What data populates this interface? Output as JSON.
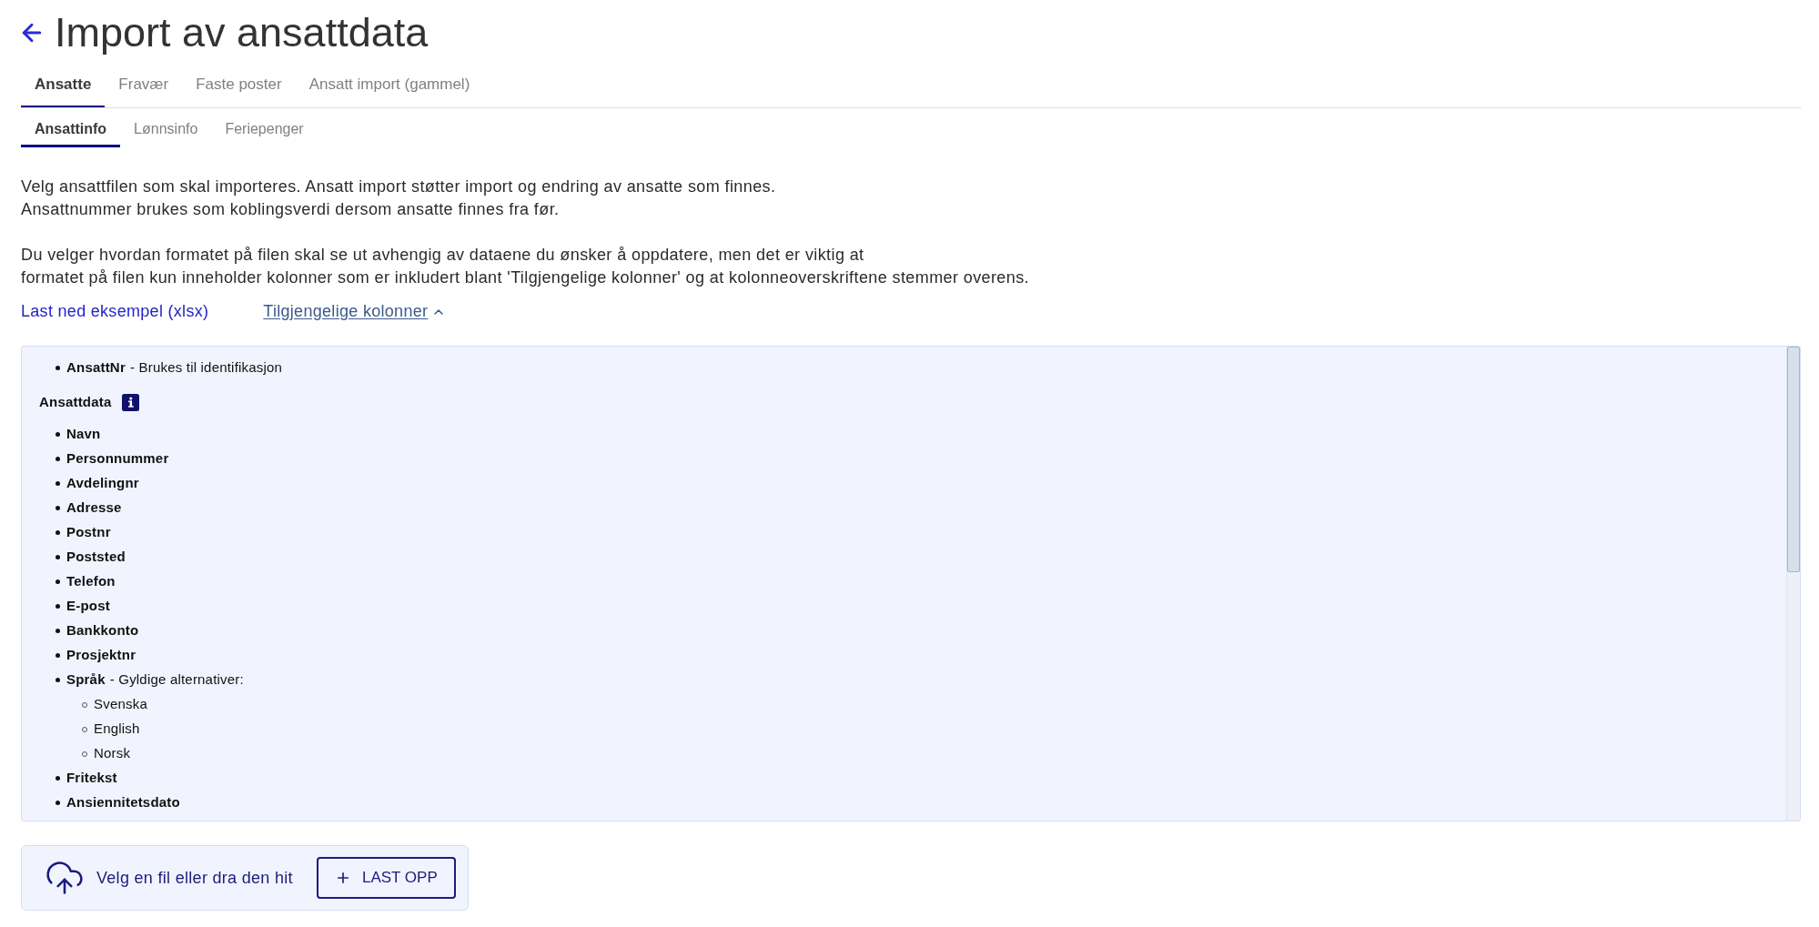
{
  "header": {
    "title": "Import av ansattdata"
  },
  "tabs": [
    {
      "label": "Ansatte",
      "selected": true
    },
    {
      "label": "Fravær",
      "selected": false
    },
    {
      "label": "Faste poster",
      "selected": false
    },
    {
      "label": "Ansatt import (gammel)",
      "selected": false
    }
  ],
  "subtabs": [
    {
      "label": "Ansattinfo",
      "selected": true
    },
    {
      "label": "Lønnsinfo",
      "selected": false
    },
    {
      "label": "Feriepenger",
      "selected": false
    }
  ],
  "description": [
    {
      "lines": [
        "Velg ansattfilen som skal importeres. Ansatt import støtter import og endring av ansatte som finnes.",
        "Ansattnummer brukes som koblingsverdi dersom ansatte finnes fra før."
      ]
    },
    {
      "lines": [
        "Du velger hvordan formatet på filen skal se ut avhengig av dataene du ønsker å oppdatere, men det er viktig at",
        "formatet på filen kun inneholder kolonner som er inkludert blant 'Tilgjengelige kolonner' og at kolonneoverskriftene stemmer overens."
      ]
    }
  ],
  "links": {
    "download": "Last ned eksempel (xlsx)",
    "columns_toggle": {
      "label": "Tilgjengelige kolonner",
      "expanded": true
    }
  },
  "columns_panel": {
    "key_columns": [
      {
        "kind": "column",
        "name": "AnsattNr",
        "note": "- Brukes til identifikasjon"
      }
    ],
    "sections": [
      {
        "title": "Ansattdata",
        "items": [
          {
            "kind": "column",
            "name": "Navn"
          },
          {
            "kind": "column",
            "name": "Personnummer"
          },
          {
            "kind": "column",
            "name": "Avdelingnr"
          },
          {
            "kind": "column",
            "name": "Adresse"
          },
          {
            "kind": "column",
            "name": "Postnr"
          },
          {
            "kind": "column",
            "name": "Poststed"
          },
          {
            "kind": "column",
            "name": "Telefon"
          },
          {
            "kind": "column",
            "name": "E-post"
          },
          {
            "kind": "column",
            "name": "Bankkonto"
          },
          {
            "kind": "column",
            "name": "Prosjektnr"
          },
          {
            "kind": "column",
            "name": "Språk",
            "note": "- Gyldige alternativer:",
            "children": [
              {
                "kind": "option",
                "name": "Svenska"
              },
              {
                "kind": "option",
                "name": "English"
              },
              {
                "kind": "option",
                "name": "Norsk"
              }
            ]
          },
          {
            "kind": "column",
            "name": "Fritekst"
          },
          {
            "kind": "column",
            "name": "Ansiennitetsdato"
          }
        ]
      }
    ]
  },
  "upload": {
    "text": "Velg en fil eller dra den hit",
    "button": "LAST OPP"
  }
}
